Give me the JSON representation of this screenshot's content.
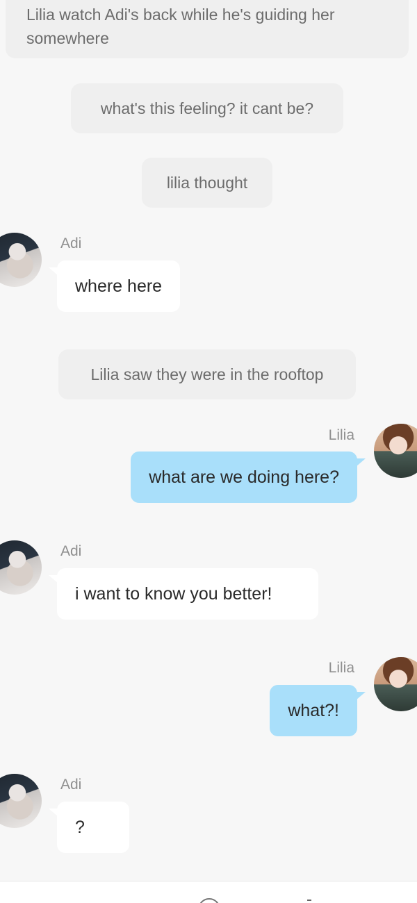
{
  "messages": {
    "narration_1": "Lilia watch Adi's back while he's guiding her somewhere",
    "narration_2": "what's this feeling? it cant be?",
    "narration_3": "lilia thought",
    "adi_name": "Adi",
    "adi_msg_1": "where here",
    "narration_4": "Lilia saw they were in the rooftop",
    "lilia_name": "Lilia",
    "lilia_msg_1": "what are we doing here?",
    "adi_msg_2": "i want to know you better!",
    "lilia_msg_2": "what?!",
    "adi_msg_3": "?"
  },
  "icons": {
    "adi_avatar": "adi-avatar",
    "lilia_avatar": "lilia-avatar",
    "bottom_icon": "circle-icon"
  },
  "colors": {
    "background": "#f7f7f7",
    "narration_bg": "#efefef",
    "adi_bubble": "#ffffff",
    "lilia_bubble": "#a9dffa"
  }
}
